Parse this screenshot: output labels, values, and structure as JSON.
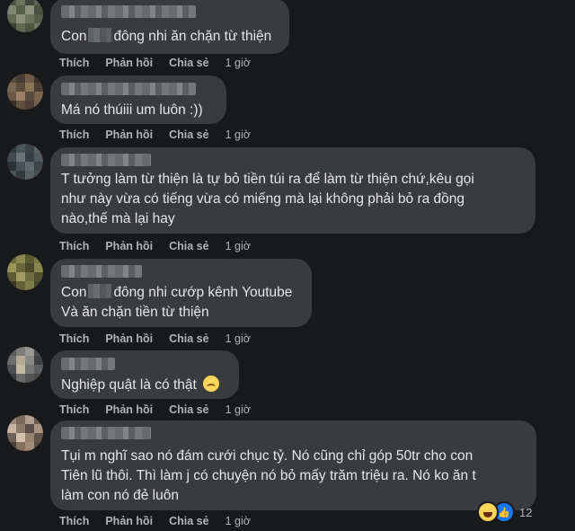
{
  "actions": {
    "like": "Thích",
    "reply": "Phản hồi",
    "share": "Chia sẻ"
  },
  "comments": [
    {
      "parts": [
        "Con",
        "đông nhi ăn chặn từ thiện"
      ],
      "time": "1 giờ"
    },
    {
      "text": "Má nó thúiii um luôn :))",
      "time": "1 giờ"
    },
    {
      "text": "T tưởng làm từ thiện là tự bỏ tiền túi ra để làm từ thiện chứ,kêu gọi\nnhư này vừa có tiếng vừa có miếng mà lại không phải bỏ ra đồng\nnào,thế mà lại hay",
      "time": "1 giờ"
    },
    {
      "parts": [
        "Con",
        "đông nhi cướp kênh Youtube"
      ],
      "line2": "Và ăn chặn tiền từ thiện",
      "time": "1 giờ"
    },
    {
      "text": "Nghiệp quật là có thật",
      "emoji": "upside-down-face-icon",
      "time": "1 giờ"
    },
    {
      "text": "Tụi m nghĩ sao nó đám cưới chục tỷ. Nó cũng chỉ góp 50tr cho con\nTiên lũ thôi. Thì làm j có chuyện nó bỏ mấy trăm triệu ra. Nó ko ăn t\nlàm con nó đẻ luôn",
      "time": "1 giờ",
      "reactions": {
        "icons": [
          "haha-icon",
          "like-icon"
        ],
        "count": "12"
      }
    }
  ]
}
